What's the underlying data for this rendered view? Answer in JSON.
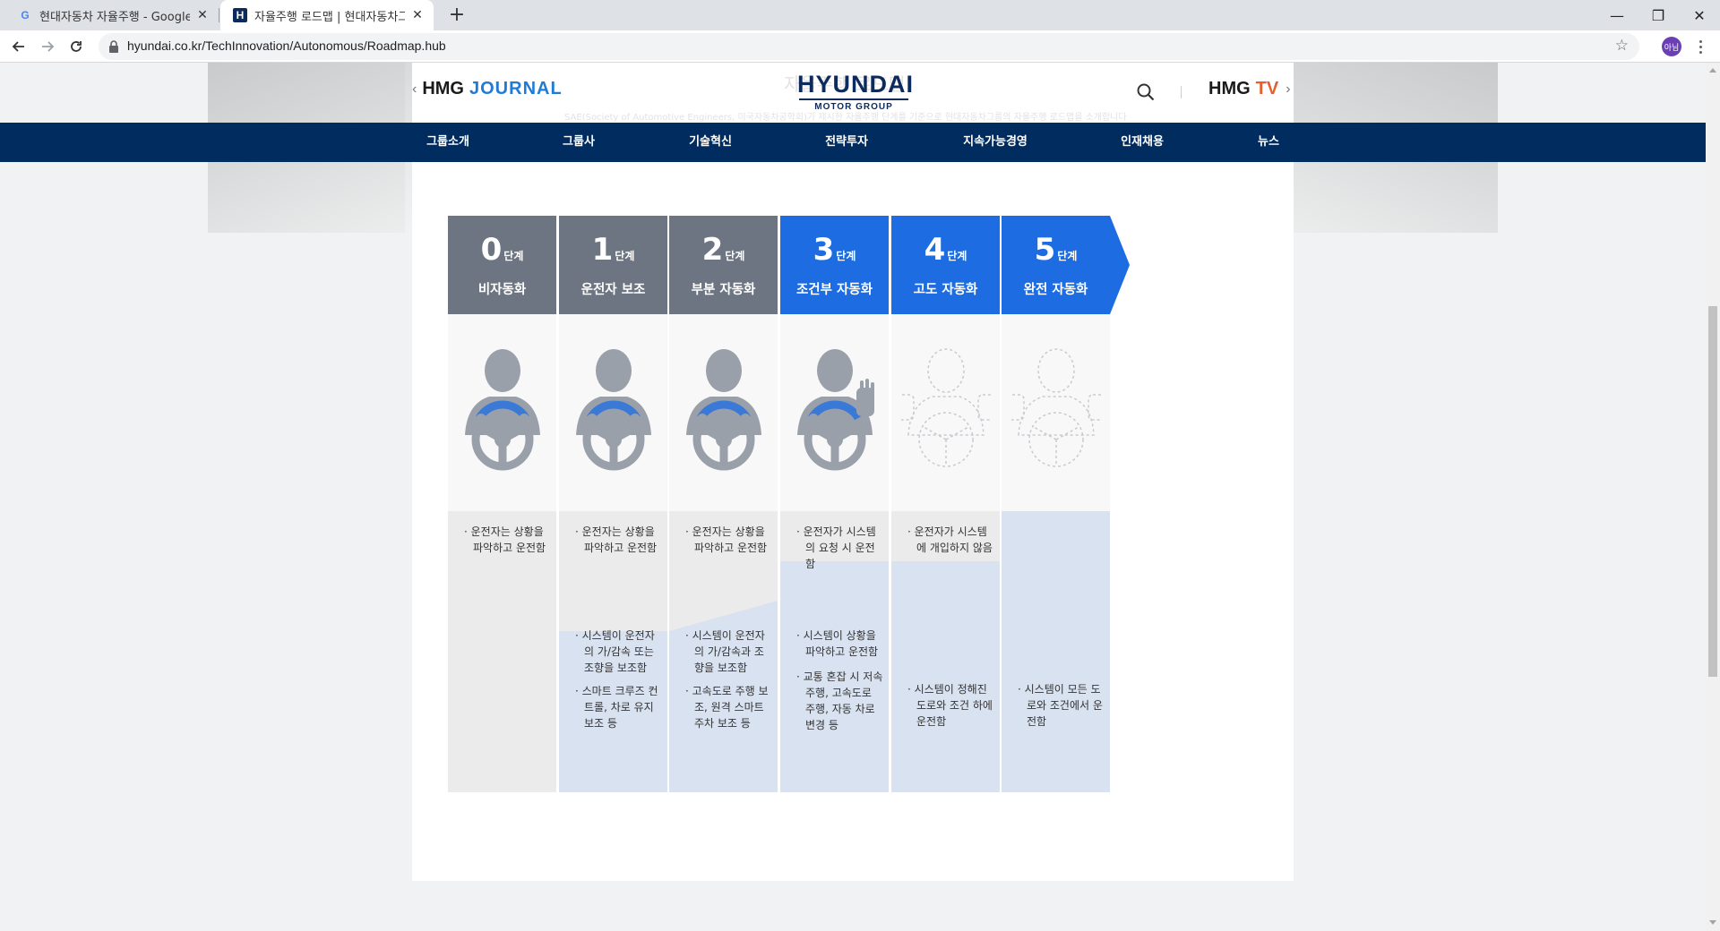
{
  "browser": {
    "tabs": [
      {
        "title": "현대자동차 자율주행 - Google 검색",
        "favicon": "google-icon",
        "active": false
      },
      {
        "title": "자율주행 로드맵 | 현대자동차그룹",
        "favicon": "hyundai-icon",
        "active": true
      }
    ],
    "new_tab": "+",
    "url": "hyundai.co.kr/TechInnovation/Autonomous/Roadmap.hub",
    "profile": "아님",
    "window_controls": [
      "—",
      "❐",
      "✕"
    ]
  },
  "header": {
    "journal": {
      "chevron": "‹",
      "hmg": "HMG",
      "accent": "JOURNAL"
    },
    "logo": {
      "brand": "HYUNDAI",
      "sub": "MOTOR GROUP"
    },
    "tv": {
      "hmg": "HMG",
      "accent": "TV",
      "chevron": "›"
    },
    "ghost_title": "자율주행 로드맵",
    "ghost_subtitle": "SAE(Society of Automotive Engineers, 미국자동차공학회)가 제시한 자율주행 단계를 기준으로 현대자동차그룹의 자율주행 로드맵을 소개합니다"
  },
  "gnb": [
    "그룹소개",
    "그룹사",
    "기술혁신",
    "전략투자",
    "지속가능경영",
    "인재채용",
    "뉴스"
  ],
  "roadmap": {
    "unit": "단계",
    "levels": [
      {
        "num": "0",
        "name": "비자동화",
        "color": "gray",
        "driver_state": "hands-on",
        "driver_notes": [
          "운전자는 상황을 파악하고 운전함"
        ],
        "system_notes": []
      },
      {
        "num": "1",
        "name": "운전자 보조",
        "color": "gray",
        "driver_state": "assisted",
        "driver_notes": [
          "운전자는 상황을 파악하고 운전함"
        ],
        "system_notes": [
          "시스템이 운전자의 가/감속 또는 조향을 보조함",
          "스마트 크루즈 컨트롤, 차로 유지 보조 등"
        ]
      },
      {
        "num": "2",
        "name": "부분 자동화",
        "color": "gray",
        "driver_state": "assisted",
        "driver_notes": [
          "운전자는 상황을 파악하고 운전함"
        ],
        "system_notes": [
          "시스템이 운전자의 가/감속과 조향을 보조함",
          "고속도로 주행 보조, 원격 스마트 주차 보조 등"
        ]
      },
      {
        "num": "3",
        "name": "조건부 자동화",
        "color": "blue",
        "driver_state": "hand-raised",
        "driver_notes": [
          "운전자가 시스템의 요청 시 운전함"
        ],
        "system_notes": [
          "시스템이 상황을 파악하고 운전함",
          "교통 혼잡 시 저속주행, 고속도로 주행, 자동 차로 변경 등"
        ]
      },
      {
        "num": "4",
        "name": "고도 자동화",
        "color": "blue",
        "driver_state": "hands-off",
        "driver_notes": [
          "운전자가 시스템에 개입하지 않음"
        ],
        "system_notes": [
          "시스템이 정해진 도로와 조건 하에 운전함"
        ]
      },
      {
        "num": "5",
        "name": "완전 자동화",
        "color": "blue",
        "driver_state": "hands-off",
        "driver_notes": [],
        "system_notes": [
          "시스템이 모든 도로와 조건에서 운전함"
        ]
      }
    ]
  },
  "colors": {
    "navy": "#002c5f",
    "gray_header": "#6c7581",
    "blue_header": "#1d6ce1",
    "system_fill": "#d9e2f0",
    "driver_fill": "#ebebec"
  }
}
